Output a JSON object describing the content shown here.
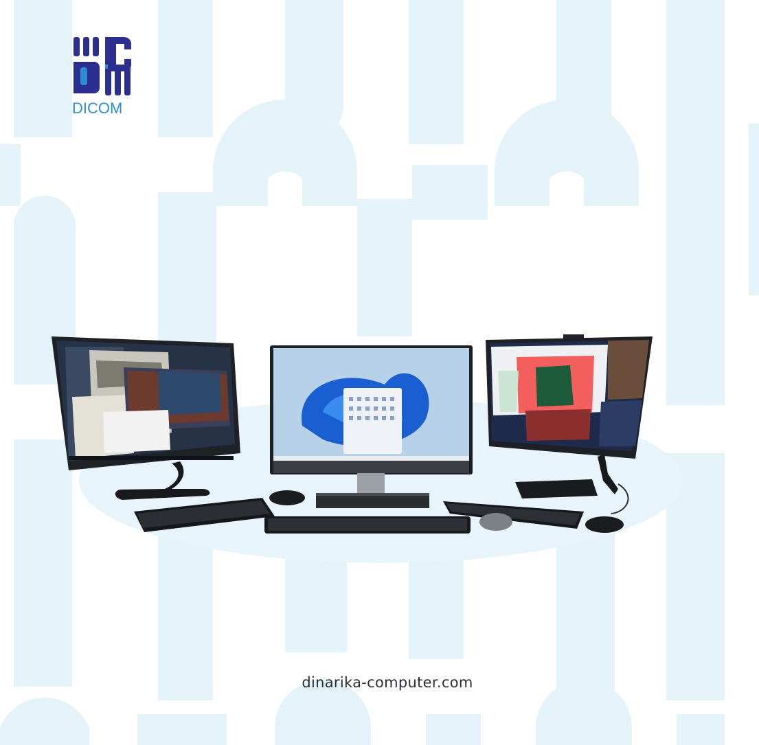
{
  "brand": {
    "name": "DICOM",
    "colors": {
      "navy": "#2c2f8f",
      "blue": "#2b8fd6",
      "pattern": "#e3f1fa"
    }
  },
  "footer": {
    "website": "dinarika-computer.com"
  },
  "products": [
    {
      "name": "all-in-one-desktop-left",
      "screen": "windows-10-desktop"
    },
    {
      "name": "all-in-one-desktop-center",
      "screen": "windows-11-start-menu"
    },
    {
      "name": "all-in-one-desktop-right",
      "screen": "windows-10-desktop-photo-app"
    }
  ]
}
